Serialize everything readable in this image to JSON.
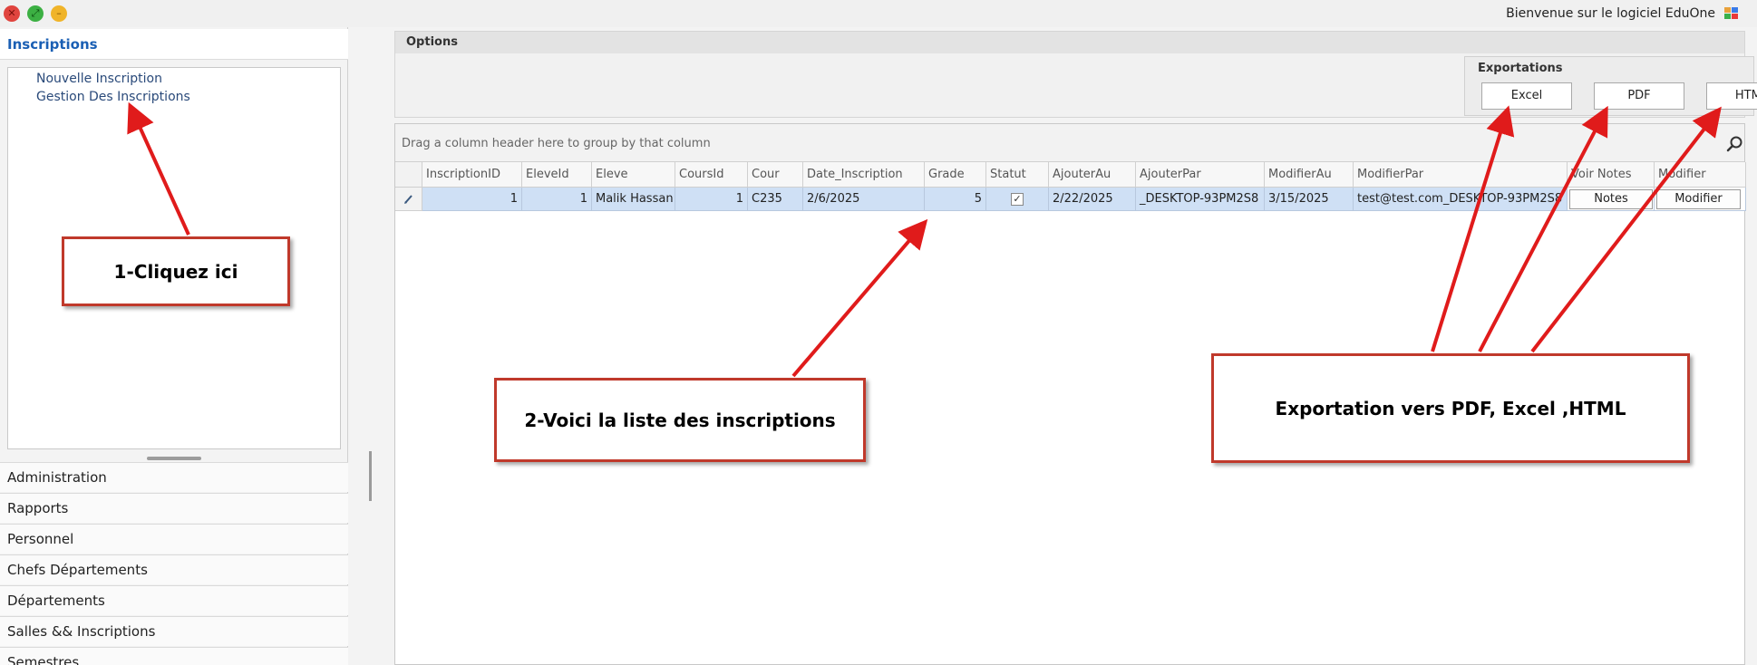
{
  "titlebar": {
    "welcome": "Bienvenue sur le logiciel EduOne"
  },
  "sidebar": {
    "header": "Inscriptions",
    "links": [
      "Nouvelle Inscription",
      "Gestion Des Inscriptions"
    ],
    "sections": [
      "Administration",
      "Rapports",
      "Personnel",
      "Chefs Départements",
      "Départements",
      "Salles && Inscriptions",
      "Semestres"
    ]
  },
  "options": {
    "title": "Options",
    "exports_title": "Exportations",
    "export_buttons": [
      "Excel",
      "PDF",
      "HTML"
    ]
  },
  "grid": {
    "group_hint": "Drag a column header here to group by that column",
    "columns": [
      "InscriptionID",
      "EleveId",
      "Eleve",
      "CoursId",
      "Cour",
      "Date_Inscription",
      "Grade",
      "Statut",
      "AjouterAu",
      "AjouterPar",
      "ModifierAu",
      "ModifierPar",
      "Voir Notes",
      "Modifier"
    ],
    "rows": [
      {
        "InscriptionID": "1",
        "EleveId": "1",
        "Eleve": "Malik Hassan",
        "CoursId": "1",
        "Cour": "C235",
        "Date_Inscription": "2/6/2025",
        "Grade": "5",
        "Statut": "✓",
        "AjouterAu": "2/22/2025",
        "AjouterPar": "_DESKTOP-93PM2S8",
        "ModifierAu": "3/15/2025",
        "ModifierPar": "test@test.com_DESKTOP-93PM2S8",
        "VoirNotes": "Notes",
        "Modifier": "Modifier"
      }
    ]
  },
  "annotations": {
    "step1": "1-Cliquez ici",
    "step2": "2-Voici la liste des inscriptions",
    "export": "Exportation vers PDF, Excel ,HTML"
  },
  "colors": {
    "accent": "#1a5fb4",
    "selected_row": "#cfe0f5",
    "annotation": "#e01b1b"
  }
}
